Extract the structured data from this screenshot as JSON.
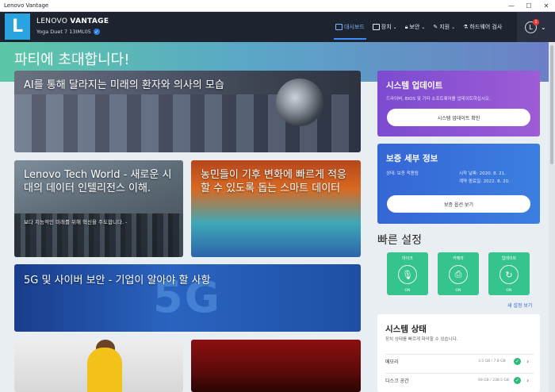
{
  "window": {
    "title": "Lenovo Vantage",
    "minimize": "—",
    "maximize": "☐",
    "close": "✕"
  },
  "header": {
    "brand_light": "LENOVO",
    "brand_bold": "VANTAGE",
    "device": "Yoga Duet 7 13IML05",
    "logo_letter": "L",
    "nav": [
      {
        "label": "대시보드",
        "icon": "dashboard-icon"
      },
      {
        "label": "장치",
        "icon": "device-icon"
      },
      {
        "label": "보안",
        "icon": "lock-icon"
      },
      {
        "label": "지원",
        "icon": "wrench-icon"
      },
      {
        "label": "하드웨어 검사",
        "icon": "flask-icon"
      }
    ],
    "avatar_letter": "L",
    "notification_count": "1"
  },
  "hero": {
    "title": "파티에 초대합니다!"
  },
  "articles": [
    {
      "title": "AI를 통해 달라지는 미래의 환자와 의사의 모습"
    },
    {
      "title": "Lenovo Tech World - 새로운 시대의 데이터 인텔리전스 이해.",
      "subtitle": "보다 지능적인 미래를 위해 혁신을 주도합니다. -"
    },
    {
      "title": "농민들이 기후 변화에 빠르게 적응할 수 있도록 돕는 스마트 데이터"
    },
    {
      "title": "5G 및 사이버 보안 - 기업이 알아야 할 사항",
      "graphic_text": "5G"
    }
  ],
  "system_update": {
    "title": "시스템 업데이트",
    "description": "드라이버, BIOS 및 기타 소프트웨어를 업데이트하십시오.",
    "button": "시스템 업데이트 확인"
  },
  "warranty": {
    "title": "보증 세부 정보",
    "status_label": "상태: 보증 적용됨",
    "start_label": "시작 날짜: 2020. 8. 21.",
    "end_label": "계약 종료일: 2022. 8. 20.",
    "button": "보증 옵션 보기"
  },
  "quick_settings": {
    "title": "빠른 설정",
    "tiles": [
      {
        "label": "마이크",
        "state": "ON",
        "icon": "microphone-icon"
      },
      {
        "label": "카메라",
        "state": "ON",
        "icon": "camera-icon"
      },
      {
        "label": "업데이트",
        "state": "ON",
        "icon": "refresh-icon"
      }
    ],
    "more_link": "새 설정 보기"
  },
  "system_status": {
    "title": "시스템 상태",
    "description": "장치 상태를 빠르게 파악할 수 있습니다.",
    "rows": [
      {
        "label": "메모리",
        "value": "3.5 GB / 7.8 GB"
      },
      {
        "label": "디스크 공간",
        "value": "69 GB / 238.5 GB"
      }
    ]
  },
  "colors": {
    "header_bg": "#1e2330",
    "logo_bg": "#2aa4e0",
    "update_card": "#8a53d3",
    "warranty_card": "#3a74de",
    "quick_tile": "#35c38e",
    "link": "#2f6fd8"
  }
}
